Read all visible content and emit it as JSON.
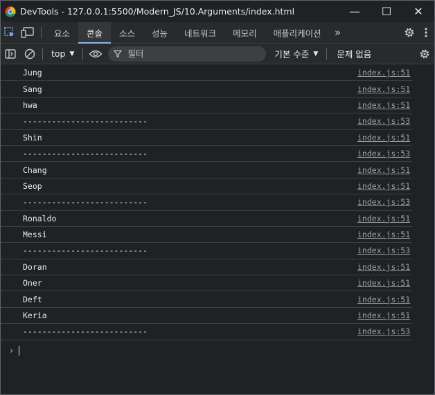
{
  "window": {
    "title": "DevTools - 127.0.0.1:5500/Modern_JS/10.Arguments/index.html",
    "minimize_glyph": "—",
    "maximize_glyph": "☐",
    "close_glyph": "✕"
  },
  "tabs": [
    {
      "label": "요소"
    },
    {
      "label": "콘솔"
    },
    {
      "label": "소스"
    },
    {
      "label": "성능"
    },
    {
      "label": "네트워크"
    },
    {
      "label": "메모리"
    },
    {
      "label": "애플리케이션"
    }
  ],
  "tab_more_glyph": "»",
  "toolbar": {
    "context": "top",
    "filter_placeholder": "필터",
    "levels": "기본 수준",
    "issues": "문제 없음"
  },
  "log": [
    {
      "text": "Jung",
      "source": "index.js:51"
    },
    {
      "text": "Sang",
      "source": "index.js:51"
    },
    {
      "text": "hwa",
      "source": "index.js:51"
    },
    {
      "text": "--------------------------",
      "source": "index.js:53"
    },
    {
      "text": "Shin",
      "source": "index.js:51"
    },
    {
      "text": "--------------------------",
      "source": "index.js:53"
    },
    {
      "text": "Chang",
      "source": "index.js:51"
    },
    {
      "text": "Seop",
      "source": "index.js:51"
    },
    {
      "text": "--------------------------",
      "source": "index.js:53"
    },
    {
      "text": "Ronaldo",
      "source": "index.js:51"
    },
    {
      "text": "Messi",
      "source": "index.js:51"
    },
    {
      "text": "--------------------------",
      "source": "index.js:53"
    },
    {
      "text": "Doran",
      "source": "index.js:51"
    },
    {
      "text": "Oner",
      "source": "index.js:51"
    },
    {
      "text": "Deft",
      "source": "index.js:51"
    },
    {
      "text": "Keria",
      "source": "index.js:51"
    },
    {
      "text": "--------------------------",
      "source": "index.js:53"
    }
  ],
  "prompt_glyph": "›",
  "colors": {
    "accent": "#8ab4f8",
    "background": "#202124",
    "panel": "#292a2d"
  }
}
